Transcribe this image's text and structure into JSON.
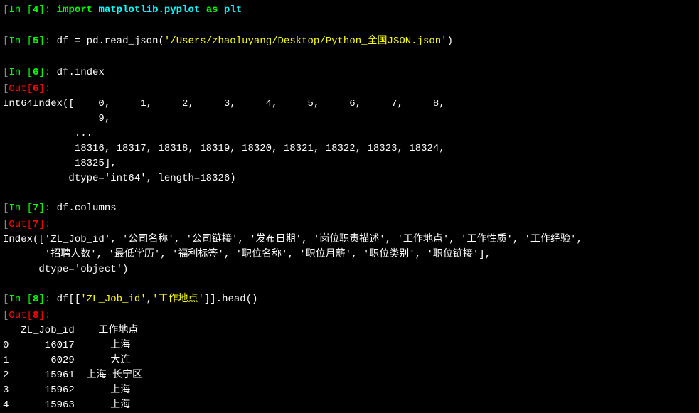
{
  "cells": [
    {
      "id": "4",
      "prompt_in": "In [",
      "prompt_close": "]:",
      "code_pre": " ",
      "code_parts": [
        {
          "text": "import",
          "cls": "green bold"
        },
        {
          "text": " ",
          "cls": "white"
        },
        {
          "text": "matplotlib.pyplot",
          "cls": "cyan bold"
        },
        {
          "text": " ",
          "cls": "white"
        },
        {
          "text": "as",
          "cls": "green bold"
        },
        {
          "text": " ",
          "cls": "white"
        },
        {
          "text": "plt",
          "cls": "cyan bold"
        }
      ]
    },
    {
      "id": "5",
      "prompt_in": "In [",
      "prompt_close": "]:",
      "code_pre": " ",
      "code_parts": [
        {
          "text": "df ",
          "cls": "white"
        },
        {
          "text": "=",
          "cls": "white"
        },
        {
          "text": " pd.read_json(",
          "cls": "white"
        },
        {
          "text": "'/Users/zhaoluyang/Desktop/Python_全国JSON.json'",
          "cls": "yellow"
        },
        {
          "text": ")",
          "cls": "white"
        }
      ]
    },
    {
      "id": "6",
      "prompt_in": "In [",
      "prompt_close": "]:",
      "code_pre": " ",
      "code_parts": [
        {
          "text": "df.index",
          "cls": "white"
        }
      ],
      "out_prompt": "Out[",
      "out_close": "]:",
      "output_lines": [
        "Int64Index([    0,     1,     2,     3,     4,     5,     6,     7,     8,",
        "                9,",
        "            ...",
        "            18316, 18317, 18318, 18319, 18320, 18321, 18322, 18323, 18324,",
        "            18325],",
        "           dtype='int64', length=18326)"
      ]
    },
    {
      "id": "7",
      "prompt_in": "In [",
      "prompt_close": "]:",
      "code_pre": " ",
      "code_parts": [
        {
          "text": "df.columns",
          "cls": "white"
        }
      ],
      "out_prompt": "Out[",
      "out_close": "]:",
      "output_lines": [
        "Index(['ZL_Job_id', '公司名称', '公司链接', '发布日期', '岗位职责描述', '工作地点', '工作性质', '工作经验',",
        "       '招聘人数', '最低学历', '福利标签', '职位名称', '职位月薪', '职位类别', '职位链接'],",
        "      dtype='object')"
      ]
    },
    {
      "id": "8",
      "prompt_in": "In [",
      "prompt_close": "]:",
      "code_pre": " ",
      "code_parts": [
        {
          "text": "df[[",
          "cls": "white"
        },
        {
          "text": "'ZL_Job_id'",
          "cls": "yellow"
        },
        {
          "text": ",",
          "cls": "white"
        },
        {
          "text": "'工作地点'",
          "cls": "yellow"
        },
        {
          "text": "]].head()",
          "cls": "white"
        }
      ],
      "out_prompt": "Out[",
      "out_close": "]:",
      "output_lines": [
        "   ZL_Job_id    工作地点",
        "0      16017      上海",
        "1       6029      大连",
        "2      15961  上海-长宁区",
        "3      15962      上海",
        "4      15963      上海"
      ]
    }
  ]
}
